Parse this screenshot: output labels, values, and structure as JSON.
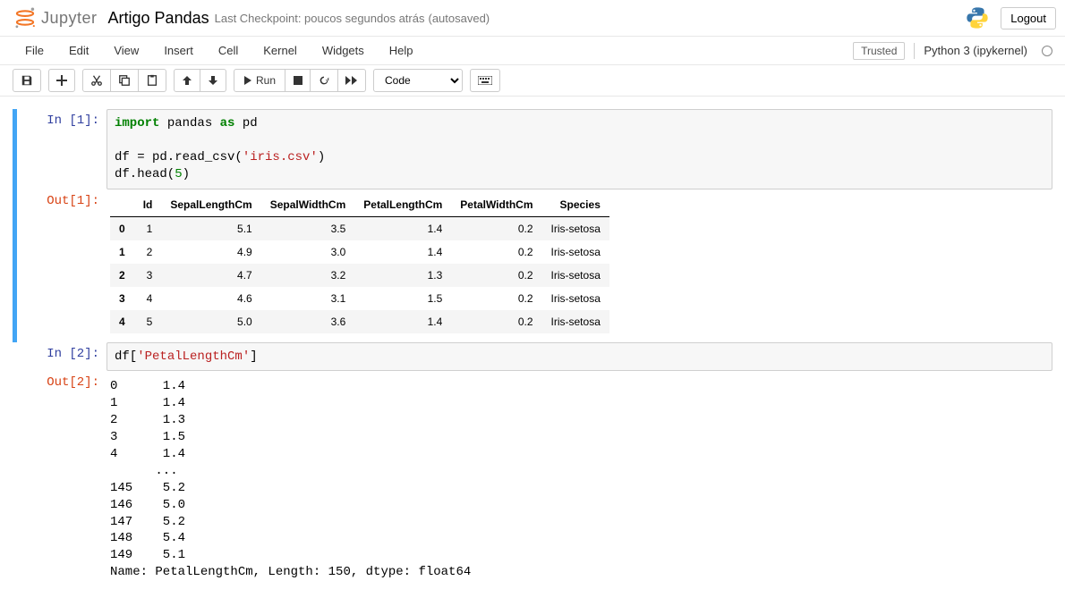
{
  "header": {
    "logo_text": "Jupyter",
    "notebook_name": "Artigo Pandas",
    "checkpoint": "Last Checkpoint: poucos segundos atrás",
    "autosaved": "(autosaved)",
    "logout": "Logout"
  },
  "menubar": {
    "items": [
      "File",
      "Edit",
      "View",
      "Insert",
      "Cell",
      "Kernel",
      "Widgets",
      "Help"
    ],
    "trusted": "Trusted",
    "kernel": "Python 3 (ipykernel)"
  },
  "toolbar": {
    "run": "Run",
    "celltype": "Code"
  },
  "cells": [
    {
      "in_prompt": "In [1]:",
      "out_prompt": "Out[1]:",
      "code_tokens": [
        [
          {
            "t": "import",
            "c": "cm-keyword"
          },
          {
            "t": " pandas "
          },
          {
            "t": "as",
            "c": "cm-keyword"
          },
          {
            "t": " pd"
          }
        ],
        [
          {
            "t": " "
          }
        ],
        [
          {
            "t": "df = pd.read_csv("
          },
          {
            "t": "'iris.csv'",
            "c": "cm-string"
          },
          {
            "t": ")"
          }
        ],
        [
          {
            "t": "df.head("
          },
          {
            "t": "5",
            "c": "cm-number"
          },
          {
            "t": ")"
          }
        ]
      ],
      "table": {
        "columns": [
          "",
          "Id",
          "SepalLengthCm",
          "SepalWidthCm",
          "PetalLengthCm",
          "PetalWidthCm",
          "Species"
        ],
        "rows": [
          [
            "0",
            "1",
            "5.1",
            "3.5",
            "1.4",
            "0.2",
            "Iris-setosa"
          ],
          [
            "1",
            "2",
            "4.9",
            "3.0",
            "1.4",
            "0.2",
            "Iris-setosa"
          ],
          [
            "2",
            "3",
            "4.7",
            "3.2",
            "1.3",
            "0.2",
            "Iris-setosa"
          ],
          [
            "3",
            "4",
            "4.6",
            "3.1",
            "1.5",
            "0.2",
            "Iris-setosa"
          ],
          [
            "4",
            "5",
            "5.0",
            "3.6",
            "1.4",
            "0.2",
            "Iris-setosa"
          ]
        ]
      }
    },
    {
      "in_prompt": "In [2]:",
      "out_prompt": "Out[2]:",
      "code_tokens": [
        [
          {
            "t": "df["
          },
          {
            "t": "'PetalLengthCm'",
            "c": "cm-string"
          },
          {
            "t": "]"
          }
        ]
      ],
      "text_output": "0      1.4\n1      1.4\n2      1.3\n3      1.5\n4      1.4\n      ... \n145    5.2\n146    5.0\n147    5.2\n148    5.4\n149    5.1\nName: PetalLengthCm, Length: 150, dtype: float64"
    }
  ]
}
